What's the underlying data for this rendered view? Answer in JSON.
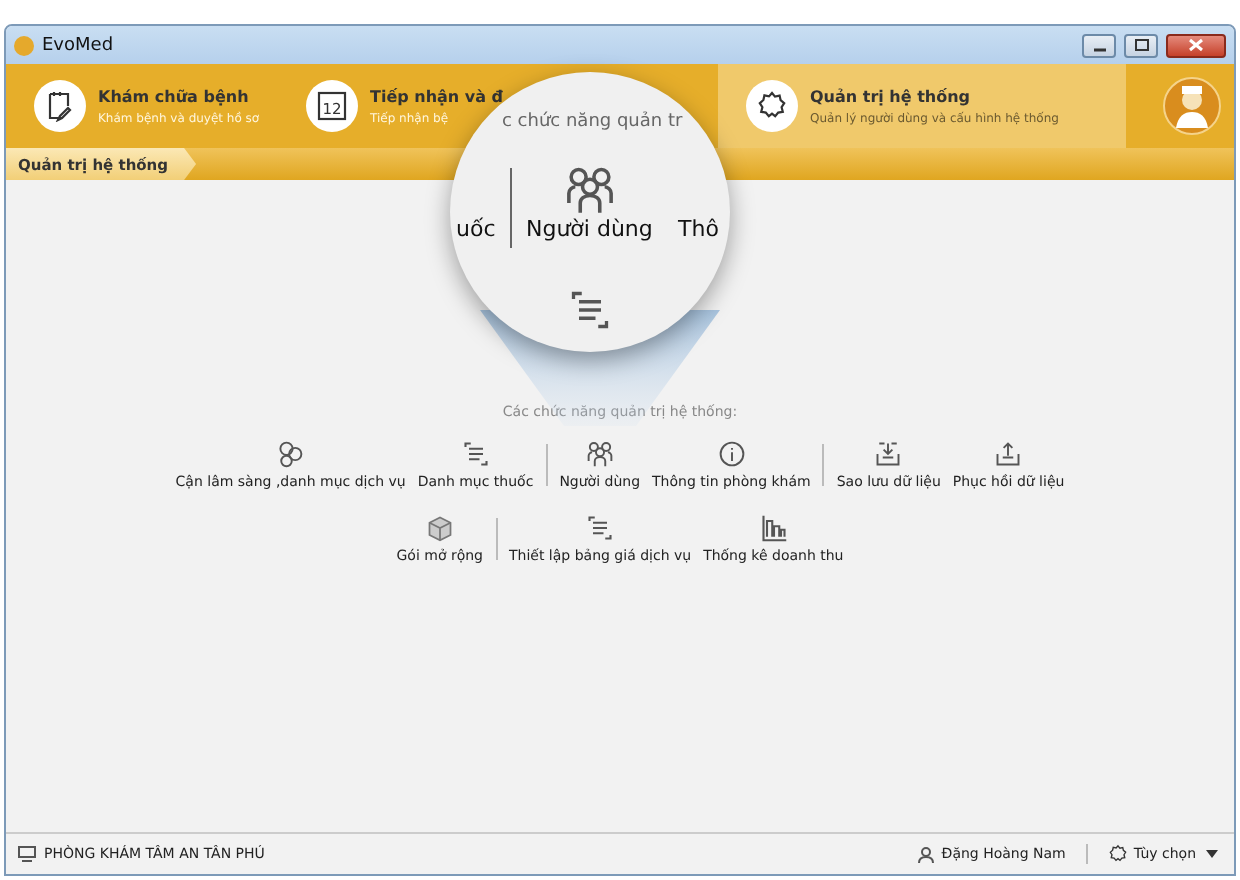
{
  "window": {
    "title": "EvoMed"
  },
  "modules": [
    {
      "title": "Khám chữa bệnh",
      "subtitle": "Khám bệnh và duyệt hồ sơ",
      "selected": false
    },
    {
      "title": "Tiếp nhận và đ",
      "subtitle": "Tiếp nhận bệ",
      "icon_text": "12",
      "selected": false
    },
    {
      "title": "Quản trị hệ thống",
      "subtitle": "Quản lý người dùng và cấu hình hệ thống",
      "selected": true
    }
  ],
  "breadcrumb": "Quản trị hệ thống",
  "functions": {
    "caption": "Các chức năng quản trị hệ thống:",
    "rows": [
      [
        [
          {
            "label": "Cận lâm sàng ,danh mục dịch vụ"
          },
          {
            "label": "Danh mục thuốc"
          }
        ],
        [
          {
            "label": "Người dùng"
          },
          {
            "label": "Thông tin phòng khám"
          }
        ],
        [
          {
            "label": "Sao lưu dữ liệu"
          },
          {
            "label": "Phục hồi dữ liệu"
          }
        ]
      ],
      [
        [
          {
            "label": "Gói mở rộng"
          }
        ],
        [
          {
            "label": "Thiết lập bảng giá dịch vụ"
          },
          {
            "label": "Thống kê doanh thu"
          }
        ]
      ]
    ]
  },
  "magnifier": {
    "caption": "c chức năng quản tr",
    "left_text": "uốc",
    "center_label": "Người dùng",
    "right_text": "Thô"
  },
  "status_bar": {
    "clinic": "PHÒNG KHÁM TÂM AN TÂN PHÚ",
    "user": "Đặng Hoàng Nam",
    "options": "Tùy chọn"
  }
}
